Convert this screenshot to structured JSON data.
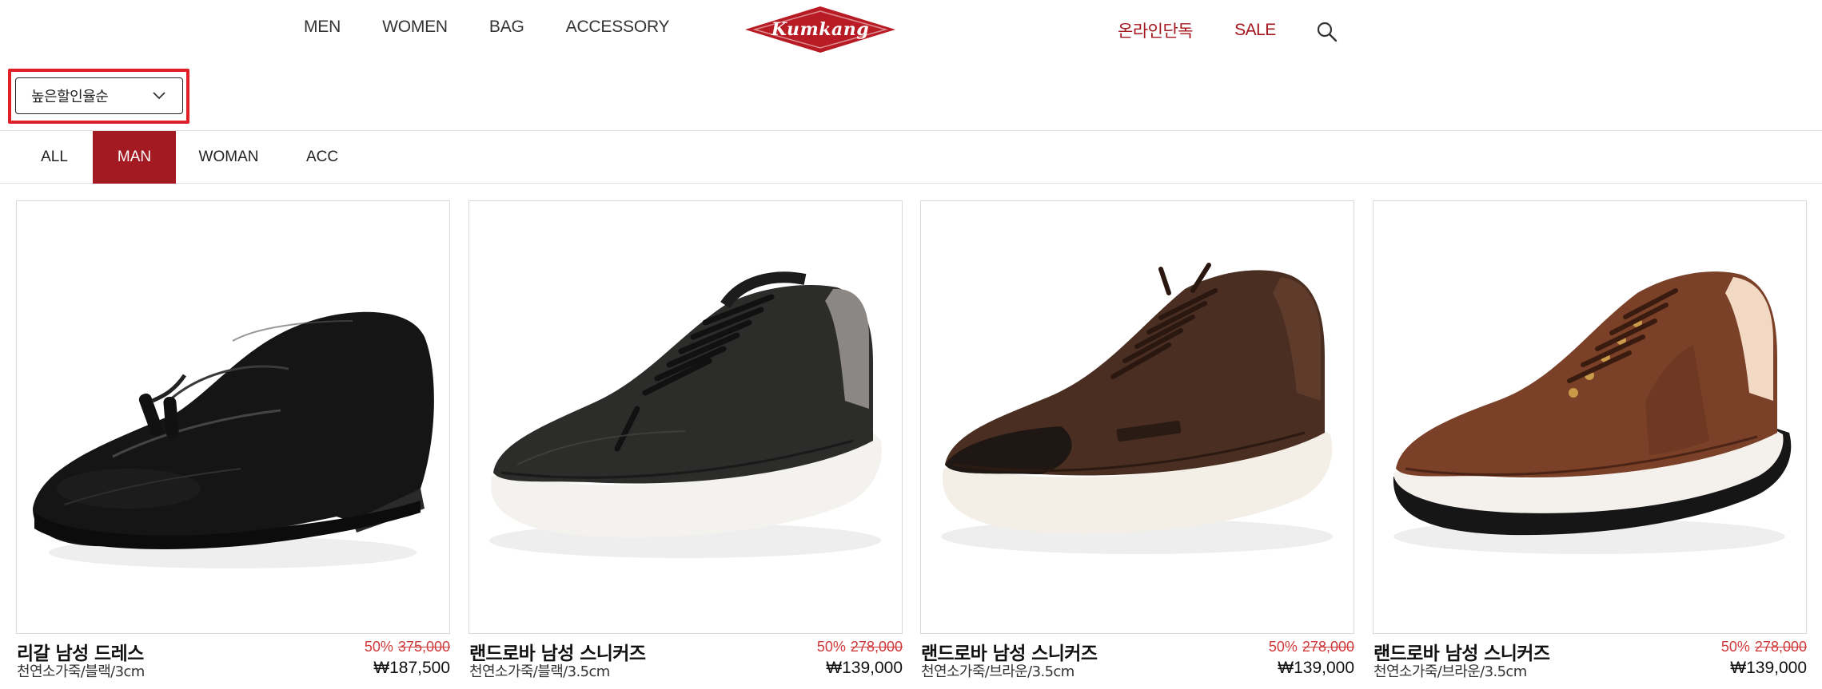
{
  "header": {
    "nav_left": [
      "MEN",
      "WOMEN",
      "BAG",
      "ACCESSORY"
    ],
    "logo_text": "Kumkang",
    "nav_right": [
      "온라인단독",
      "SALE"
    ],
    "search_icon": "search-icon"
  },
  "colors": {
    "brand_red": "#a41a22",
    "logo_red": "#b81b23",
    "discount_red": "#d03a3a",
    "highlight_red": "#e02028"
  },
  "sort": {
    "selected": "높은할인율순",
    "icon": "chevron-down-icon"
  },
  "tabs": [
    {
      "label": "ALL",
      "active": false
    },
    {
      "label": "MAN",
      "active": true
    },
    {
      "label": "WOMAN",
      "active": false
    },
    {
      "label": "ACC",
      "active": false
    }
  ],
  "products": [
    {
      "name": "리갈 남성 드레스",
      "desc": "천연소가죽/블랙/3cm",
      "discount": "50%",
      "original_price": "375,000",
      "price": "₩187,500",
      "image": "black-tassel-loafer"
    },
    {
      "name": "랜드로바 남성 스니커즈",
      "desc": "천연소가죽/블랙/3.5cm",
      "discount": "50%",
      "original_price": "278,000",
      "price": "₩139,000",
      "image": "black-leather-sneaker"
    },
    {
      "name": "랜드로바 남성 스니커즈",
      "desc": "천연소가죽/브라운/3.5cm",
      "discount": "50%",
      "original_price": "278,000",
      "price": "₩139,000",
      "image": "dark-brown-leather-sneaker"
    },
    {
      "name": "랜드로바 남성 스니커즈",
      "desc": "천연소가죽/브라운/3.5cm",
      "discount": "50%",
      "original_price": "278,000",
      "price": "₩139,000",
      "image": "brown-leather-sneaker"
    }
  ]
}
